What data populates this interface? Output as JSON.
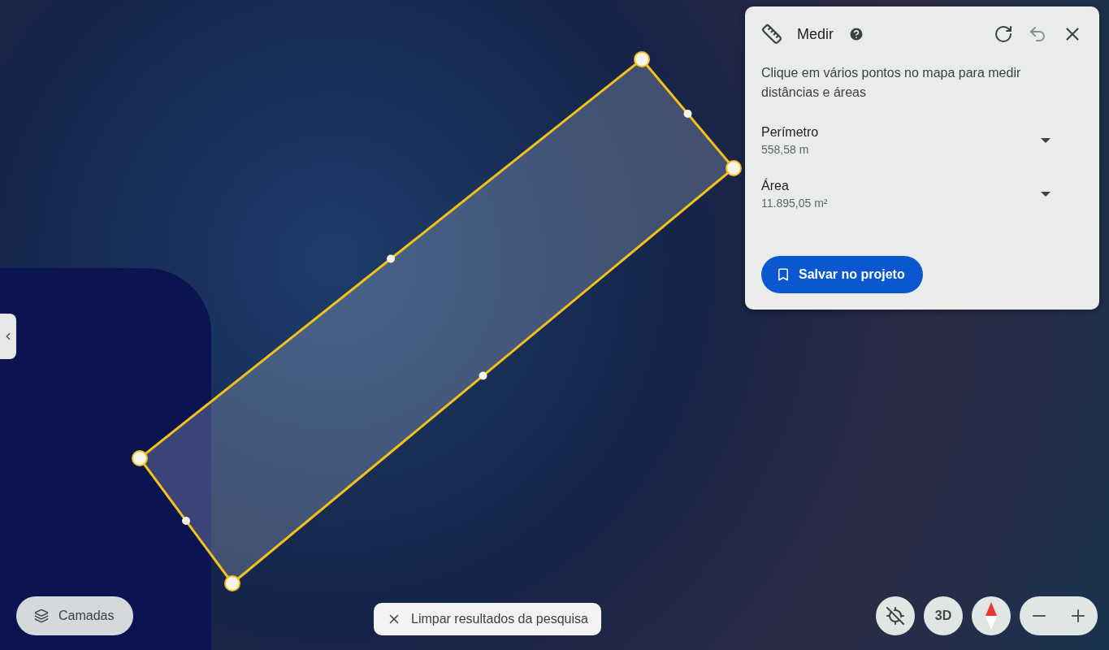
{
  "measure_panel": {
    "title": "Medir",
    "description": "Clique em vários pontos no mapa para medir distâncias e áreas",
    "measurements": [
      {
        "label": "Perímetro",
        "value": "558,58 m"
      },
      {
        "label": "Área",
        "value": "11.895,05 m²"
      }
    ],
    "save_button": "Salvar no projeto"
  },
  "layers_button": "Camadas",
  "clear_search_button": "Limpar resultados da pesquisa",
  "map_controls": {
    "view_3d": "3D"
  }
}
